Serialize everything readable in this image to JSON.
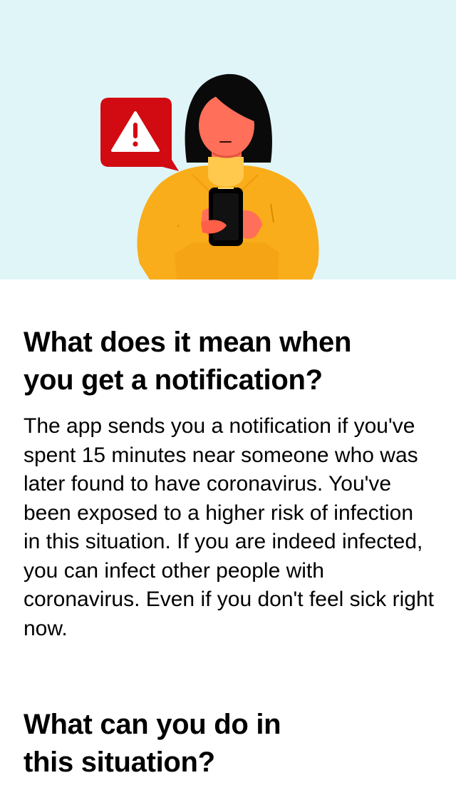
{
  "header": {
    "illustration_icon": "person-holding-phone-with-warning-icon",
    "warning_icon": "warning-triangle-icon"
  },
  "section1": {
    "title": "What does it mean when you get a notification?",
    "body": "The app sends you a notification if you've spent 15 minutes near someone who was later found to have coronavirus. You've been exposed to a higher risk of infection in this situation. If you are indeed infected, you can infect other people with coronavirus. Even if you don't feel sick right now."
  },
  "section2": {
    "title": "What can you do in this situation?"
  },
  "colors": {
    "hero_background": "#e0f5f8",
    "alert_red": "#d20a11",
    "sweater": "#f9ad1a",
    "skin": "#ff6f59",
    "hair": "#0a0a0a"
  }
}
